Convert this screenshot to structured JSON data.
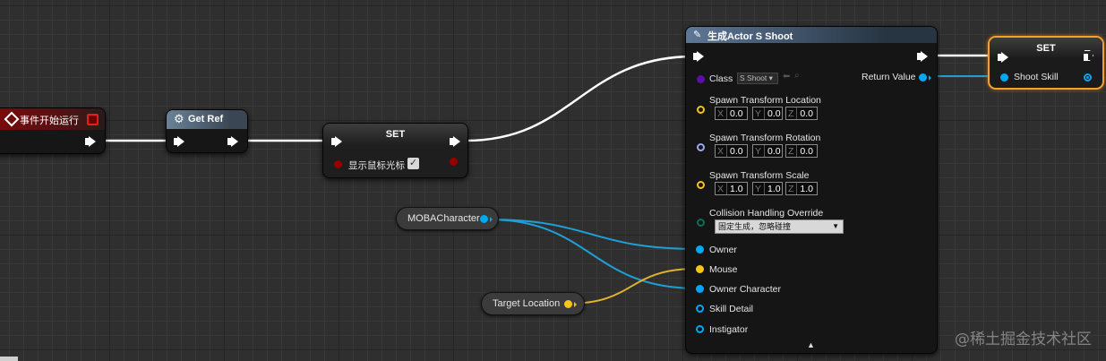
{
  "colors": {
    "exec": "#ffffff",
    "object_blue": "#00a8f3",
    "vector_gold": "#f5c518",
    "rotator": "#9ea7f5",
    "enum_green": "#0b6d56",
    "class_purple": "#5b0fa8",
    "bool_red": "#960000",
    "event_header": "#8b0d0d",
    "pure_header": "#5a6f86"
  },
  "event_node": {
    "title": "事件开始运行",
    "icon": "event-diamond-icon"
  },
  "get_ref_node": {
    "title": "Get Ref",
    "icon": "function-gear-icon"
  },
  "set_node_1": {
    "title": "SET",
    "var_label": "显示鼠标光标",
    "checked": true
  },
  "spawn_node": {
    "title": "生成Actor S Shoot",
    "icon": "spawn-icon",
    "class_label": "Class",
    "class_value": "S Shoot",
    "return_label": "Return Value",
    "location_label": "Spawn Transform Location",
    "location": {
      "x": "0.0",
      "y": "0.0",
      "z": "0.0"
    },
    "rotation_label": "Spawn Transform Rotation",
    "rotation": {
      "x": "0.0",
      "y": "0.0",
      "z": "0.0"
    },
    "scale_label": "Spawn Transform Scale",
    "scale": {
      "x": "1.0",
      "y": "1.0",
      "z": "1.0"
    },
    "axis": {
      "x": "X",
      "y": "Y",
      "z": "Z"
    },
    "collision_label": "Collision Handling Override",
    "collision_value": "固定生成，忽略碰撞",
    "owner_label": "Owner",
    "mouse_label": "Mouse",
    "owner_character_label": "Owner Character",
    "skill_detail_label": "Skill Detail",
    "instigator_label": "Instigator"
  },
  "set_node_2": {
    "title": "SET",
    "var_label": "Shoot Skill"
  },
  "moba_var": {
    "label": "MOBACharacter"
  },
  "target_var": {
    "label": "Target Location"
  },
  "watermark": "@稀土掘金技术社区"
}
